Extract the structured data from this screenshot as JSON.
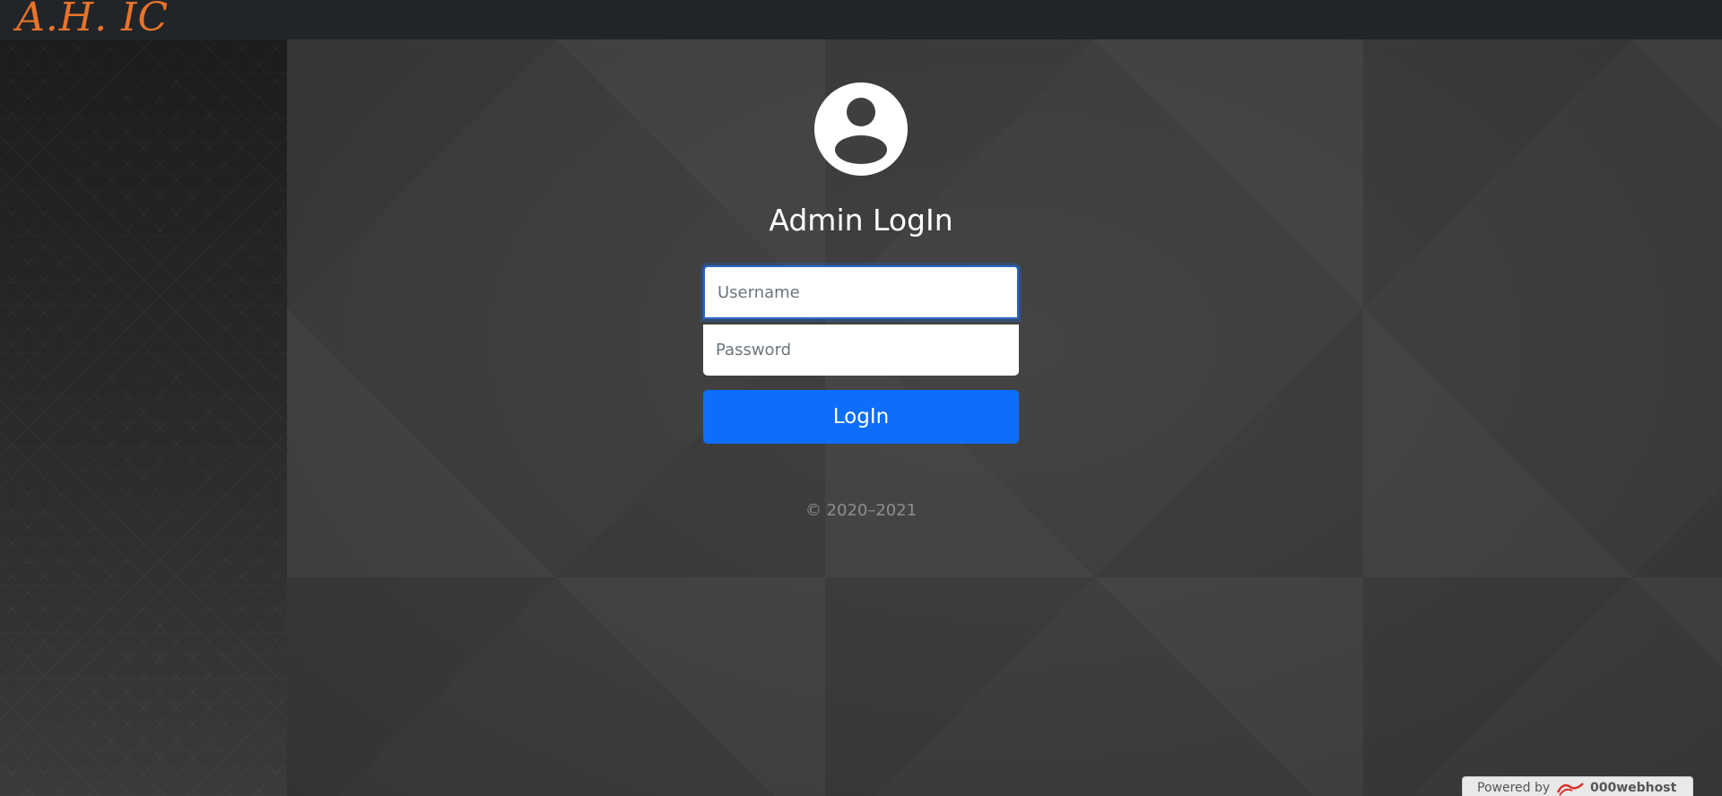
{
  "header": {
    "brand": "A.H. IC"
  },
  "login": {
    "title": "Admin LogIn",
    "avatar_icon": "user-circle-icon",
    "username": {
      "value": "",
      "placeholder": "Username"
    },
    "password": {
      "value": "",
      "placeholder": "Password"
    },
    "submit_label": "LogIn",
    "copyright": "© 2020–2021"
  },
  "footer": {
    "powered_label": "Powered by",
    "host_name": "000webhost",
    "host_icon": "000webhost-logo-icon"
  },
  "colors": {
    "topbar": "#212529",
    "brand": "#e8732a",
    "primary": "#0d6efd",
    "background": "#3b3b3b"
  }
}
